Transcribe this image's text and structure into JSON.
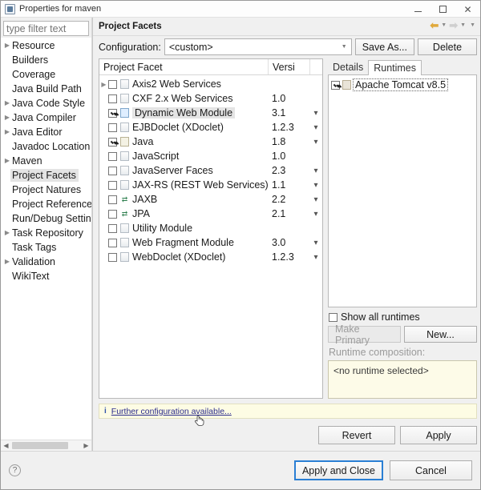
{
  "window": {
    "title": "Properties for maven",
    "icon": "properties-icon",
    "controls": {
      "minimize": "–",
      "maximize": "□",
      "close": "✕"
    }
  },
  "sidebar": {
    "filter": {
      "value": "",
      "placeholder": "type filter text"
    },
    "items": [
      {
        "label": "Resource",
        "expandable": true,
        "selected": false
      },
      {
        "label": "Builders",
        "expandable": false,
        "selected": false
      },
      {
        "label": "Coverage",
        "expandable": false,
        "selected": false
      },
      {
        "label": "Java Build Path",
        "expandable": false,
        "selected": false
      },
      {
        "label": "Java Code Style",
        "expandable": true,
        "selected": false
      },
      {
        "label": "Java Compiler",
        "expandable": true,
        "selected": false
      },
      {
        "label": "Java Editor",
        "expandable": true,
        "selected": false
      },
      {
        "label": "Javadoc Location",
        "expandable": false,
        "selected": false
      },
      {
        "label": "Maven",
        "expandable": true,
        "selected": false
      },
      {
        "label": "Project Facets",
        "expandable": false,
        "selected": true
      },
      {
        "label": "Project Natures",
        "expandable": false,
        "selected": false
      },
      {
        "label": "Project References",
        "expandable": false,
        "selected": false
      },
      {
        "label": "Run/Debug Settings",
        "expandable": false,
        "selected": false
      },
      {
        "label": "Task Repository",
        "expandable": true,
        "selected": false
      },
      {
        "label": "Task Tags",
        "expandable": false,
        "selected": false
      },
      {
        "label": "Validation",
        "expandable": true,
        "selected": false
      },
      {
        "label": "WikiText",
        "expandable": false,
        "selected": false
      }
    ]
  },
  "content": {
    "header_title": "Project Facets",
    "nav": {
      "back": "back-arrow",
      "forward": "forward-arrow",
      "menu": "dropdown-caret"
    },
    "configuration": {
      "label": "Configuration:",
      "selected": "<custom>",
      "save_as_label": "Save As...",
      "delete_label": "Delete"
    },
    "facet_table": {
      "columns": [
        "Project Facet",
        "Versi"
      ],
      "rows": [
        {
          "name": "Axis2 Web Services",
          "version": "",
          "checked": false,
          "expandable": true,
          "selected": false,
          "icon": "doc",
          "has_menu": false
        },
        {
          "name": "CXF 2.x Web Services",
          "version": "1.0",
          "checked": false,
          "expandable": false,
          "selected": false,
          "icon": "doc",
          "has_menu": false
        },
        {
          "name": "Dynamic Web Module",
          "version": "3.1",
          "checked": true,
          "expandable": false,
          "selected": true,
          "icon": "web",
          "has_menu": true
        },
        {
          "name": "EJBDoclet (XDoclet)",
          "version": "1.2.3",
          "checked": false,
          "expandable": false,
          "selected": false,
          "icon": "doc",
          "has_menu": true
        },
        {
          "name": "Java",
          "version": "1.8",
          "checked": true,
          "expandable": false,
          "selected": false,
          "icon": "java",
          "has_menu": true
        },
        {
          "name": "JavaScript",
          "version": "1.0",
          "checked": false,
          "expandable": false,
          "selected": false,
          "icon": "doc",
          "has_menu": false
        },
        {
          "name": "JavaServer Faces",
          "version": "2.3",
          "checked": false,
          "expandable": false,
          "selected": false,
          "icon": "doc",
          "has_menu": true
        },
        {
          "name": "JAX-RS (REST Web Services)",
          "version": "1.1",
          "checked": false,
          "expandable": false,
          "selected": false,
          "icon": "doc",
          "has_menu": true
        },
        {
          "name": "JAXB",
          "version": "2.2",
          "checked": false,
          "expandable": false,
          "selected": false,
          "icon": "arrow",
          "has_menu": true
        },
        {
          "name": "JPA",
          "version": "2.1",
          "checked": false,
          "expandable": false,
          "selected": false,
          "icon": "arrow",
          "has_menu": true
        },
        {
          "name": "Utility Module",
          "version": "",
          "checked": false,
          "expandable": false,
          "selected": false,
          "icon": "doc",
          "has_menu": false
        },
        {
          "name": "Web Fragment Module",
          "version": "3.0",
          "checked": false,
          "expandable": false,
          "selected": false,
          "icon": "doc",
          "has_menu": true
        },
        {
          "name": "WebDoclet (XDoclet)",
          "version": "1.2.3",
          "checked": false,
          "expandable": false,
          "selected": false,
          "icon": "doc",
          "has_menu": true
        }
      ]
    },
    "detail_pane": {
      "tabs": [
        {
          "label": "Details",
          "active": false
        },
        {
          "label": "Runtimes",
          "active": true
        }
      ],
      "runtimes": [
        {
          "label": "Apache Tomcat v8.5",
          "checked": true,
          "focused": true
        }
      ],
      "show_all_runtimes": {
        "label": "Show all runtimes",
        "checked": false
      },
      "make_primary_label": "Make Primary",
      "new_label": "New...",
      "runtime_composition_label": "Runtime composition:",
      "runtime_composition_value": "<no runtime selected>"
    },
    "info_bar": {
      "icon": "info-icon",
      "link_text": "Further configuration available..."
    },
    "revert_label": "Revert",
    "apply_label": "Apply"
  },
  "footer": {
    "help_icon": "?",
    "apply_and_close_label": "Apply and Close",
    "cancel_label": "Cancel"
  }
}
